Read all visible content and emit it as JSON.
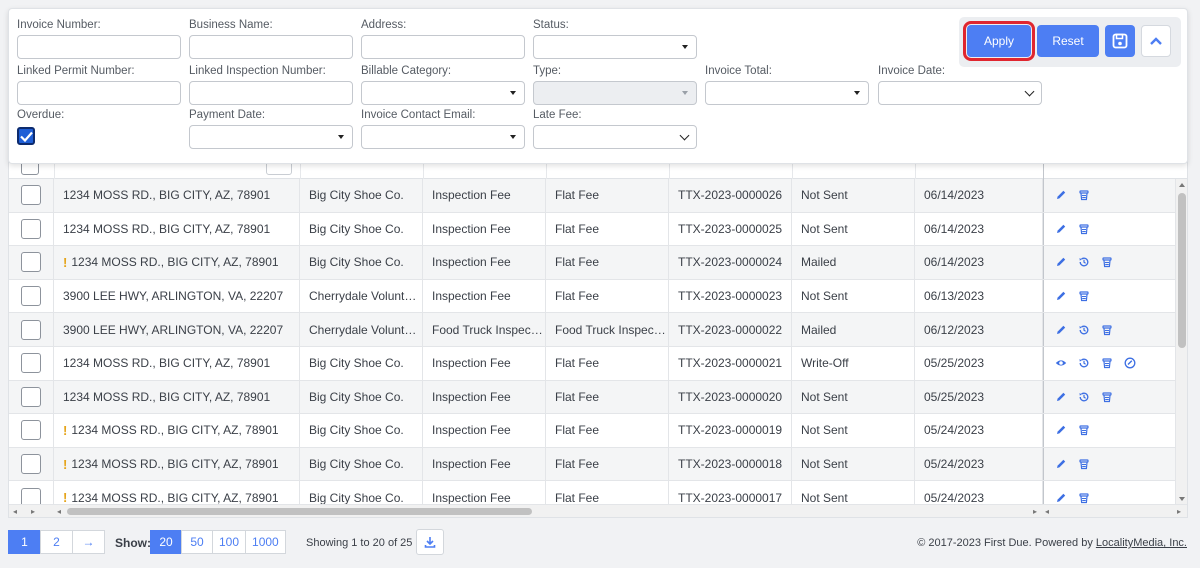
{
  "filters": {
    "invoice_number": {
      "label": "Invoice Number:",
      "value": ""
    },
    "business_name": {
      "label": "Business Name:",
      "value": ""
    },
    "address": {
      "label": "Address:",
      "value": ""
    },
    "status": {
      "label": "Status:",
      "value": ""
    },
    "linked_permit_number": {
      "label": "Linked Permit Number:",
      "value": ""
    },
    "linked_inspection_number": {
      "label": "Linked Inspection Number:",
      "value": ""
    },
    "billable_category": {
      "label": "Billable Category:",
      "value": ""
    },
    "type": {
      "label": "Type:",
      "value": ""
    },
    "invoice_total": {
      "label": "Invoice Total:",
      "value": ""
    },
    "invoice_date": {
      "label": "Invoice Date:",
      "value": ""
    },
    "overdue": {
      "label": "Overdue:",
      "checked": true
    },
    "payment_date": {
      "label": "Payment Date:",
      "value": ""
    },
    "invoice_contact_email": {
      "label": "Invoice Contact Email:",
      "value": ""
    },
    "late_fee": {
      "label": "Late Fee:",
      "value": ""
    }
  },
  "buttons": {
    "apply": "Apply",
    "reset": "Reset",
    "save_icon": "floppy-disk-icon",
    "collapse_icon": "chevron-up-icon"
  },
  "rows": [
    {
      "warn": false,
      "address": "1234 MOSS RD., BIG CITY, AZ, 78901",
      "business": "Big City Shoe Co.",
      "category": "Inspection Fee",
      "type": "Flat Fee",
      "number": "TTX-2023-0000026",
      "status": "Not Sent",
      "date": "06/14/2023",
      "actions": [
        "edit",
        "delete"
      ]
    },
    {
      "warn": false,
      "address": "1234 MOSS RD., BIG CITY, AZ, 78901",
      "business": "Big City Shoe Co.",
      "category": "Inspection Fee",
      "type": "Flat Fee",
      "number": "TTX-2023-0000025",
      "status": "Not Sent",
      "date": "06/14/2023",
      "actions": [
        "edit",
        "delete"
      ]
    },
    {
      "warn": true,
      "address": "1234 MOSS RD., BIG CITY, AZ, 78901",
      "business": "Big City Shoe Co.",
      "category": "Inspection Fee",
      "type": "Flat Fee",
      "number": "TTX-2023-0000024",
      "status": "Mailed",
      "date": "06/14/2023",
      "actions": [
        "edit",
        "history",
        "delete"
      ]
    },
    {
      "warn": false,
      "address": "3900 LEE HWY, ARLINGTON, VA, 22207",
      "business": "Cherrydale Volunt…",
      "category": "Inspection Fee",
      "type": "Flat Fee",
      "number": "TTX-2023-0000023",
      "status": "Not Sent",
      "date": "06/13/2023",
      "actions": [
        "edit",
        "delete"
      ]
    },
    {
      "warn": false,
      "address": "3900 LEE HWY, ARLINGTON, VA, 22207",
      "business": "Cherrydale Volunt…",
      "category": "Food Truck Inspect…",
      "type": "Food Truck Inspect…",
      "number": "TTX-2023-0000022",
      "status": "Mailed",
      "date": "06/12/2023",
      "actions": [
        "edit",
        "history",
        "delete"
      ]
    },
    {
      "warn": false,
      "address": "1234 MOSS RD., BIG CITY, AZ, 78901",
      "business": "Big City Shoe Co.",
      "category": "Inspection Fee",
      "type": "Flat Fee",
      "number": "TTX-2023-0000021",
      "status": "Write-Off",
      "date": "05/25/2023",
      "actions": [
        "view",
        "history",
        "delete",
        "paid"
      ]
    },
    {
      "warn": false,
      "address": "1234 MOSS RD., BIG CITY, AZ, 78901",
      "business": "Big City Shoe Co.",
      "category": "Inspection Fee",
      "type": "Flat Fee",
      "number": "TTX-2023-0000020",
      "status": "Not Sent",
      "date": "05/25/2023",
      "actions": [
        "edit",
        "history",
        "delete"
      ]
    },
    {
      "warn": true,
      "address": "1234 MOSS RD., BIG CITY, AZ, 78901",
      "business": "Big City Shoe Co.",
      "category": "Inspection Fee",
      "type": "Flat Fee",
      "number": "TTX-2023-0000019",
      "status": "Not Sent",
      "date": "05/24/2023",
      "actions": [
        "edit",
        "delete"
      ]
    },
    {
      "warn": true,
      "address": "1234 MOSS RD., BIG CITY, AZ, 78901",
      "business": "Big City Shoe Co.",
      "category": "Inspection Fee",
      "type": "Flat Fee",
      "number": "TTX-2023-0000018",
      "status": "Not Sent",
      "date": "05/24/2023",
      "actions": [
        "edit",
        "delete"
      ]
    },
    {
      "warn": true,
      "address": "1234 MOSS RD., BIG CITY, AZ, 78901",
      "business": "Big City Shoe Co.",
      "category": "Inspection Fee",
      "type": "Flat Fee",
      "number": "TTX-2023-0000017",
      "status": "Not Sent",
      "date": "05/24/2023",
      "actions": [
        "edit",
        "delete"
      ]
    }
  ],
  "pagination": {
    "pages": [
      "1",
      "2",
      "→"
    ],
    "active_page": "1",
    "show_label": "Show:",
    "sizes": [
      "20",
      "50",
      "100",
      "1000"
    ],
    "active_size": "20",
    "showing_text": "Showing 1 to 20 of 25",
    "download_icon": "download-icon"
  },
  "footer": {
    "copyright_prefix": "© 2017-2023 First Due. Powered by ",
    "copyright_link": "LocalityMedia, Inc."
  },
  "colors": {
    "accent": "#4d7ef3",
    "apply_highlight": "#e0262f",
    "warning": "#e5a41a",
    "checkbox_checked": "#1f5fd6"
  }
}
